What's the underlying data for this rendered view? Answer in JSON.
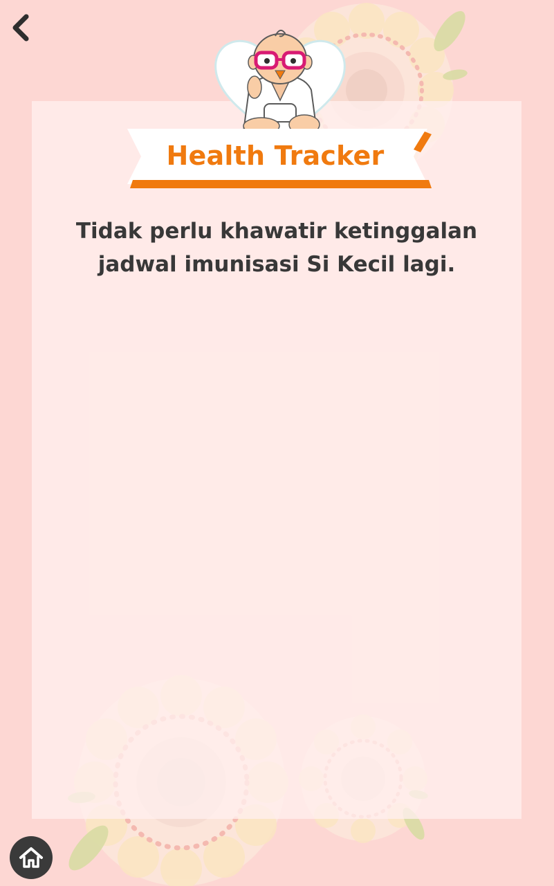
{
  "header": {
    "back_icon": "chevron-left-icon"
  },
  "banner": {
    "title": "Health Tracker",
    "title_color": "#f07a0f"
  },
  "content": {
    "description_lines": [
      "Tidak perlu khawatir ketinggalan",
      "jadwal imunisasi Si Kecil lagi."
    ]
  },
  "footer": {
    "home_icon": "home-icon"
  },
  "colors": {
    "background": "#fdd7d3",
    "accent": "#f07a0f",
    "text": "#383838",
    "home_button": "#3a3a3a"
  }
}
